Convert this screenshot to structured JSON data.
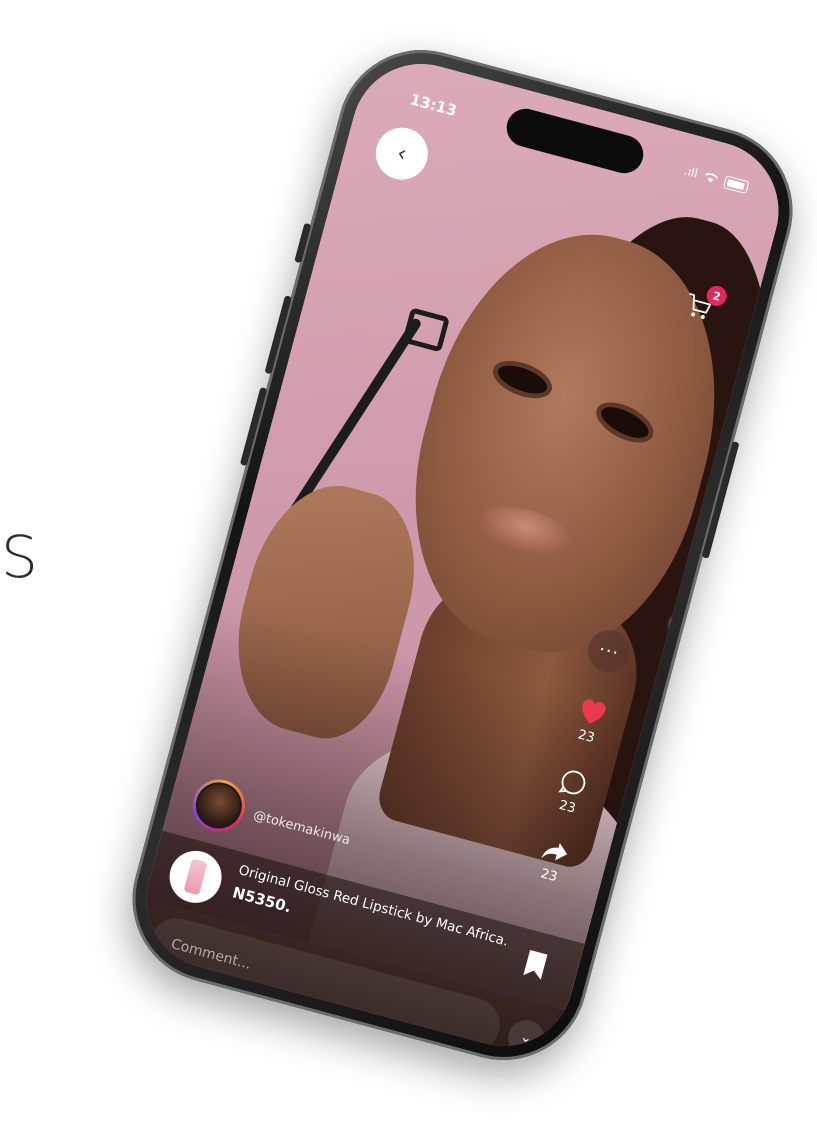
{
  "side_text": "S",
  "status": {
    "time": "13:13",
    "signal": ".ıll"
  },
  "cart": {
    "badge_count": "2"
  },
  "back_label": "‹",
  "more_label": "···",
  "actions": {
    "likes": "23",
    "comments": "23",
    "shares": "23"
  },
  "author": {
    "handle": "@tokemakinwa"
  },
  "product": {
    "title": "Original Gloss Red Lipstick by Mac Africa.",
    "price": "N5350."
  },
  "comment": {
    "placeholder": "Comment..."
  },
  "expand_label": "⌄",
  "colors": {
    "accent": "#e4285c",
    "heart": "#e93a4f"
  }
}
